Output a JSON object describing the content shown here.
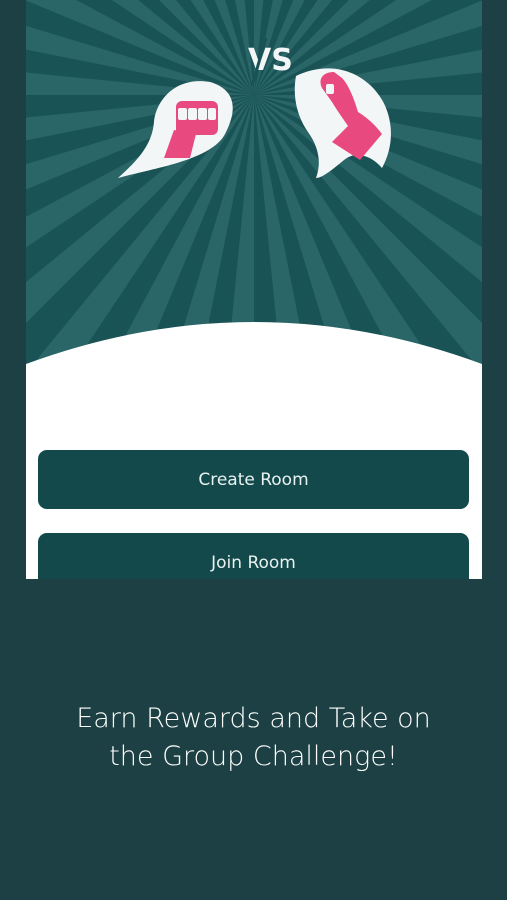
{
  "hero": {
    "vs_text": "VS",
    "left_icon": "fist-on-fire-icon",
    "right_icon": "raised-arm-on-fire-icon",
    "colors": {
      "background": "#1c4043",
      "burst_dark": "#1a5355",
      "burst_light": "#2a6567",
      "flame": "#f3f6f7",
      "fist": "#e8497f"
    }
  },
  "actions": {
    "create_room_label": "Create Room",
    "join_room_label": "Join Room",
    "button_color": "#14494c"
  },
  "promo": {
    "line1": "Earn Rewards and Take on",
    "line2": "the Group Challenge!"
  }
}
